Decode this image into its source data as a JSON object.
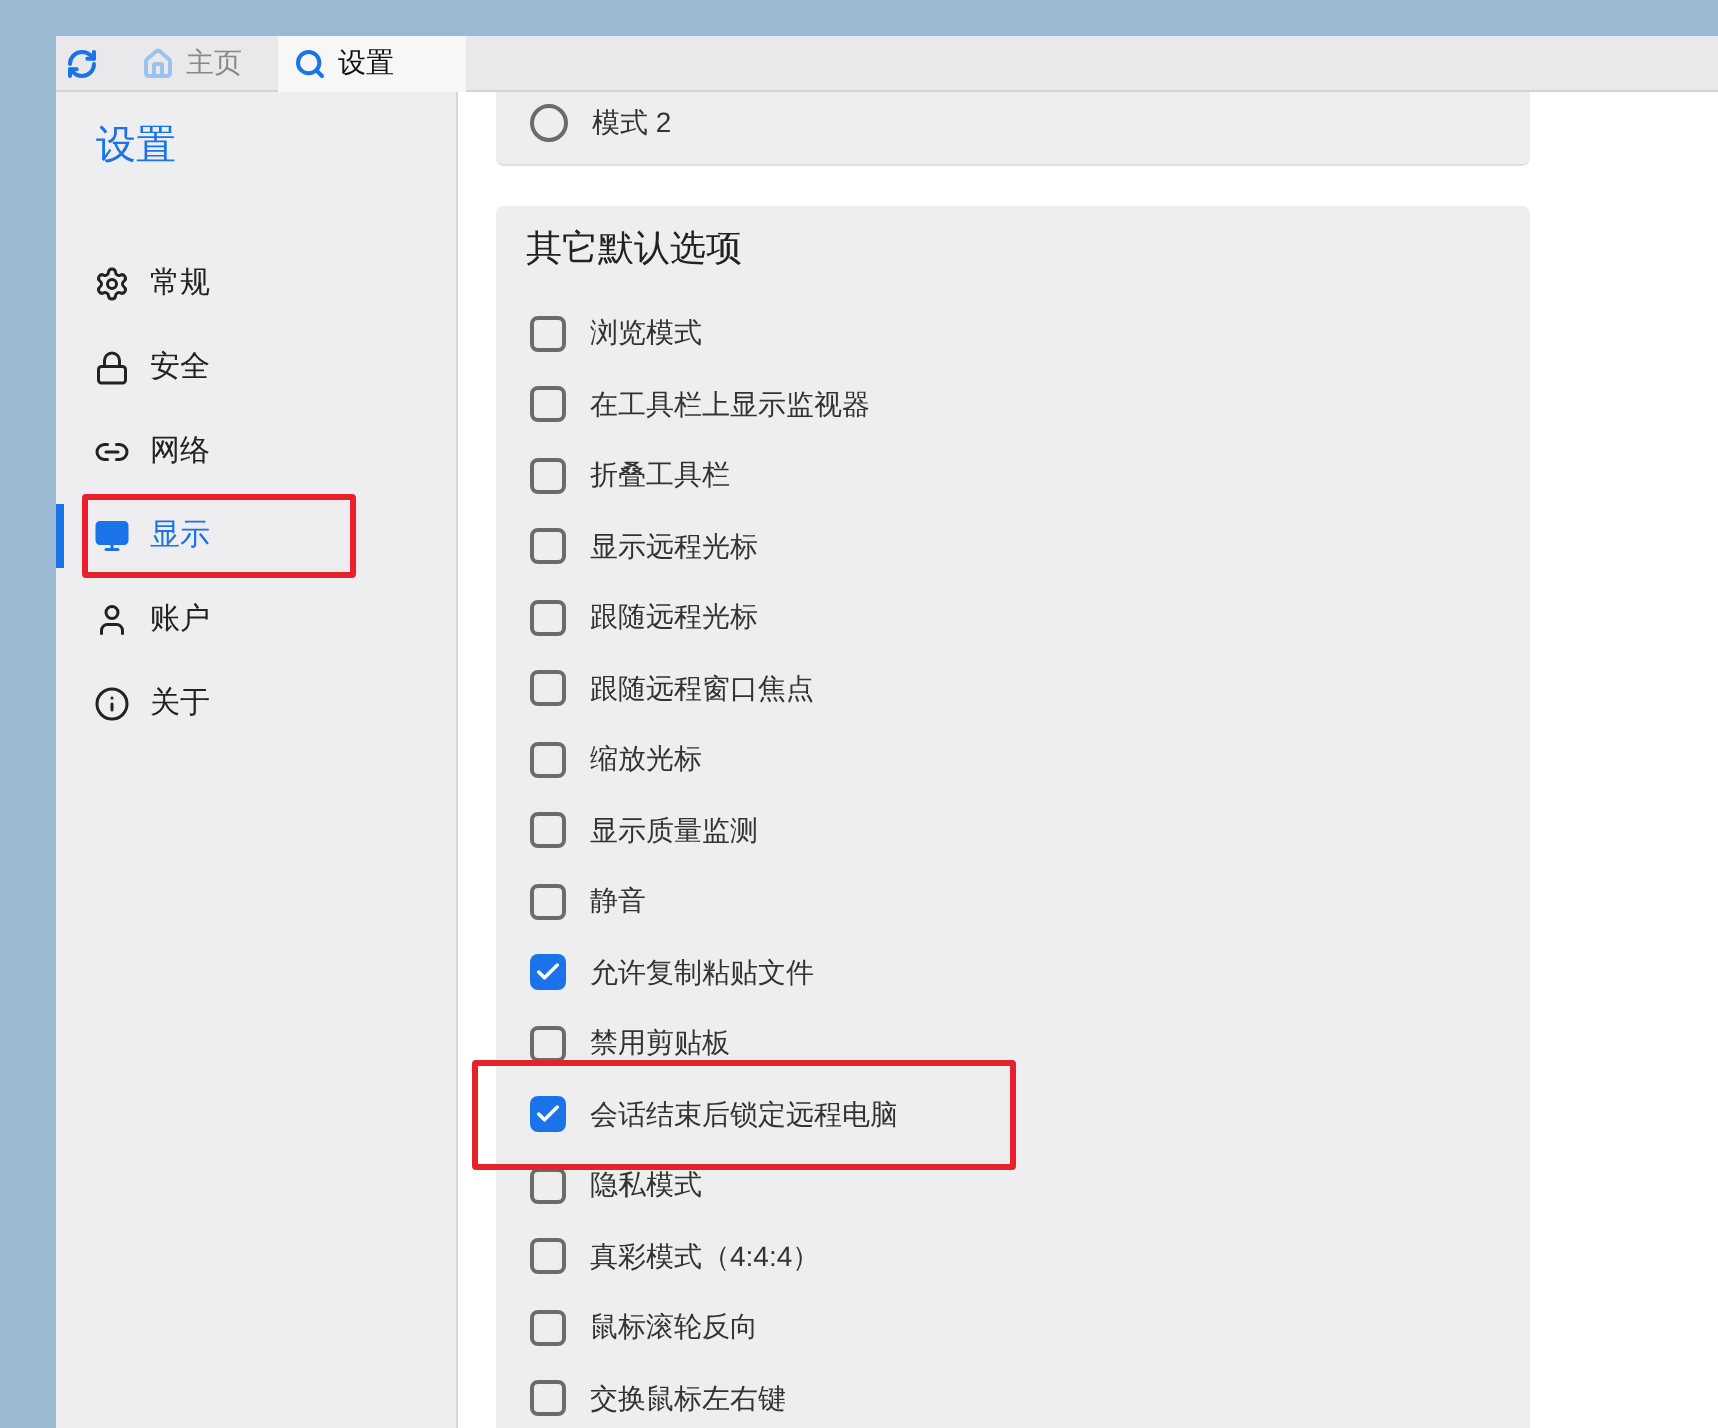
{
  "tabs": [
    {
      "label": "主页",
      "kind": "home",
      "selected": false
    },
    {
      "label": "设置",
      "kind": "settings",
      "selected": true
    }
  ],
  "sidebar": {
    "title": "设置",
    "items": [
      {
        "label": "常规",
        "kind": "gear",
        "selected": false,
        "highlighted": false
      },
      {
        "label": "安全",
        "kind": "lock",
        "selected": false,
        "highlighted": false
      },
      {
        "label": "网络",
        "kind": "link",
        "selected": false,
        "highlighted": false
      },
      {
        "label": "显示",
        "kind": "monitor",
        "selected": true,
        "highlighted": true
      },
      {
        "label": "账户",
        "kind": "user",
        "selected": false,
        "highlighted": false
      },
      {
        "label": "关于",
        "kind": "info",
        "selected": false,
        "highlighted": false
      }
    ]
  },
  "mode_card": {
    "options": [
      {
        "label": "模式 2",
        "selected": false
      }
    ]
  },
  "defaults_card": {
    "title": "其它默认选项",
    "options": [
      {
        "label": "浏览模式",
        "checked": false,
        "highlighted": false
      },
      {
        "label": "在工具栏上显示监视器",
        "checked": false,
        "highlighted": false
      },
      {
        "label": "折叠工具栏",
        "checked": false,
        "highlighted": false
      },
      {
        "label": "显示远程光标",
        "checked": false,
        "highlighted": false
      },
      {
        "label": "跟随远程光标",
        "checked": false,
        "highlighted": false
      },
      {
        "label": "跟随远程窗口焦点",
        "checked": false,
        "highlighted": false
      },
      {
        "label": "缩放光标",
        "checked": false,
        "highlighted": false
      },
      {
        "label": "显示质量监测",
        "checked": false,
        "highlighted": false
      },
      {
        "label": "静音",
        "checked": false,
        "highlighted": false
      },
      {
        "label": "允许复制粘贴文件",
        "checked": true,
        "highlighted": false
      },
      {
        "label": "禁用剪贴板",
        "checked": false,
        "highlighted": false
      },
      {
        "label": "会话结束后锁定远程电脑",
        "checked": true,
        "highlighted": true
      },
      {
        "label": "隐私模式",
        "checked": false,
        "highlighted": false
      },
      {
        "label": "真彩模式（4:4:4）",
        "checked": false,
        "highlighted": false
      },
      {
        "label": "鼠标滚轮反向",
        "checked": false,
        "highlighted": false
      },
      {
        "label": "交换鼠标左右键",
        "checked": false,
        "highlighted": false
      }
    ]
  }
}
